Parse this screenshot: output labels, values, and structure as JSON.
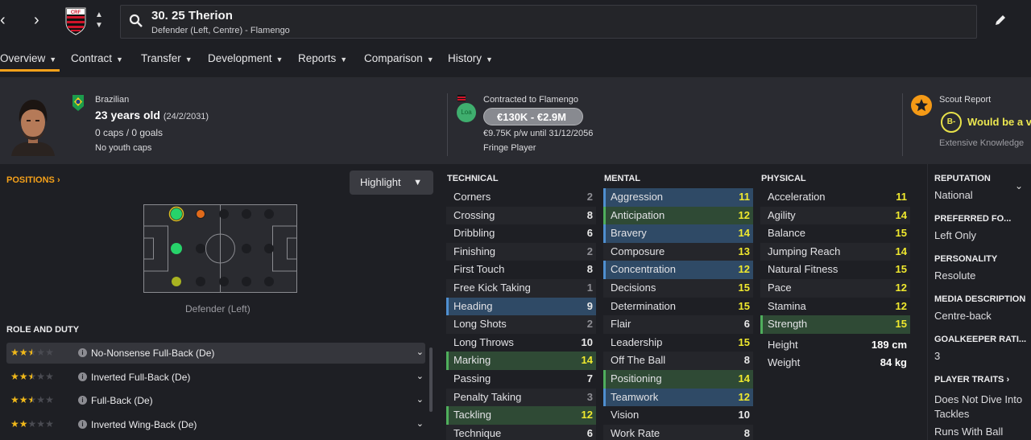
{
  "player": {
    "title": "30. 25 Therion",
    "subtitle": "Defender (Left, Centre) - Flamengo"
  },
  "tabs": [
    "Overview",
    "Contract",
    "Transfer",
    "Development",
    "Reports",
    "Comparison",
    "History"
  ],
  "profile": {
    "nationality": "Brazilian",
    "age": "23 years old",
    "dob": "(24/2/2031)",
    "caps": "0 caps / 0 goals",
    "youth": "No youth caps"
  },
  "contract": {
    "label": "Contracted to Flamengo",
    "loa": "Loa",
    "value": "€130K - €2.9M",
    "wage": "€9.75K p/w until 31/12/2056",
    "status": "Fringe Player"
  },
  "scout": {
    "label": "Scout Report",
    "grade": "B-",
    "text": "Would be a ve",
    "knowledge": "Extensive Knowledge"
  },
  "positions": {
    "label": "POSITIONS",
    "highlight": "Highlight",
    "caption": "Defender (Left)"
  },
  "roles": {
    "label": "ROLE AND DUTY",
    "items": [
      {
        "name": "No-Nonsense Full-Back (De)",
        "stars": 2.5
      },
      {
        "name": "Inverted Full-Back (De)",
        "stars": 2.5
      },
      {
        "name": "Full-Back (De)",
        "stars": 2.5
      },
      {
        "name": "Inverted Wing-Back (De)",
        "stars": 2
      }
    ]
  },
  "colors": {
    "accent": "#f7a11a",
    "good": "#f0e92e",
    "mid": "#eaeaea",
    "low": "#8e8e94"
  },
  "technical": {
    "label": "TECHNICAL",
    "rows": [
      {
        "name": "Corners",
        "value": "2",
        "hl": ""
      },
      {
        "name": "Crossing",
        "value": "8",
        "hl": ""
      },
      {
        "name": "Dribbling",
        "value": "6",
        "hl": ""
      },
      {
        "name": "Finishing",
        "value": "2",
        "hl": ""
      },
      {
        "name": "First Touch",
        "value": "8",
        "hl": ""
      },
      {
        "name": "Free Kick Taking",
        "value": "1",
        "hl": ""
      },
      {
        "name": "Heading",
        "value": "9",
        "hl": "blue"
      },
      {
        "name": "Long Shots",
        "value": "2",
        "hl": ""
      },
      {
        "name": "Long Throws",
        "value": "10",
        "hl": ""
      },
      {
        "name": "Marking",
        "value": "14",
        "hl": "green"
      },
      {
        "name": "Passing",
        "value": "7",
        "hl": ""
      },
      {
        "name": "Penalty Taking",
        "value": "3",
        "hl": ""
      },
      {
        "name": "Tackling",
        "value": "12",
        "hl": "green"
      },
      {
        "name": "Technique",
        "value": "6",
        "hl": ""
      }
    ]
  },
  "mental": {
    "label": "MENTAL",
    "rows": [
      {
        "name": "Aggression",
        "value": "11",
        "hl": "blue"
      },
      {
        "name": "Anticipation",
        "value": "12",
        "hl": "green"
      },
      {
        "name": "Bravery",
        "value": "14",
        "hl": "blue"
      },
      {
        "name": "Composure",
        "value": "13",
        "hl": ""
      },
      {
        "name": "Concentration",
        "value": "12",
        "hl": "blue"
      },
      {
        "name": "Decisions",
        "value": "15",
        "hl": ""
      },
      {
        "name": "Determination",
        "value": "15",
        "hl": ""
      },
      {
        "name": "Flair",
        "value": "6",
        "hl": ""
      },
      {
        "name": "Leadership",
        "value": "15",
        "hl": ""
      },
      {
        "name": "Off The Ball",
        "value": "8",
        "hl": ""
      },
      {
        "name": "Positioning",
        "value": "14",
        "hl": "green"
      },
      {
        "name": "Teamwork",
        "value": "12",
        "hl": "blue"
      },
      {
        "name": "Vision",
        "value": "10",
        "hl": ""
      },
      {
        "name": "Work Rate",
        "value": "8",
        "hl": ""
      }
    ]
  },
  "physical": {
    "label": "PHYSICAL",
    "rows": [
      {
        "name": "Acceleration",
        "value": "11",
        "hl": ""
      },
      {
        "name": "Agility",
        "value": "14",
        "hl": ""
      },
      {
        "name": "Balance",
        "value": "15",
        "hl": ""
      },
      {
        "name": "Jumping Reach",
        "value": "14",
        "hl": ""
      },
      {
        "name": "Natural Fitness",
        "value": "15",
        "hl": ""
      },
      {
        "name": "Pace",
        "value": "12",
        "hl": ""
      },
      {
        "name": "Stamina",
        "value": "12",
        "hl": ""
      },
      {
        "name": "Strength",
        "value": "15",
        "hl": "green"
      }
    ],
    "height_label": "Height",
    "height": "189 cm",
    "weight_label": "Weight",
    "weight": "84 kg"
  },
  "side": {
    "reputation_label": "REPUTATION",
    "reputation": "National",
    "foot_label": "PREFERRED FO...",
    "foot": "Left Only",
    "personality_label": "PERSONALITY",
    "personality": "Resolute",
    "media_label": "MEDIA DESCRIPTION",
    "media": "Centre-back",
    "gk_label": "GOALKEEPER RATI...",
    "gk": "3",
    "traits_label": "PLAYER TRAITS",
    "trait1": "Does Not Dive Into",
    "trait1b": "Tackles",
    "trait2": "Runs With Ball"
  }
}
